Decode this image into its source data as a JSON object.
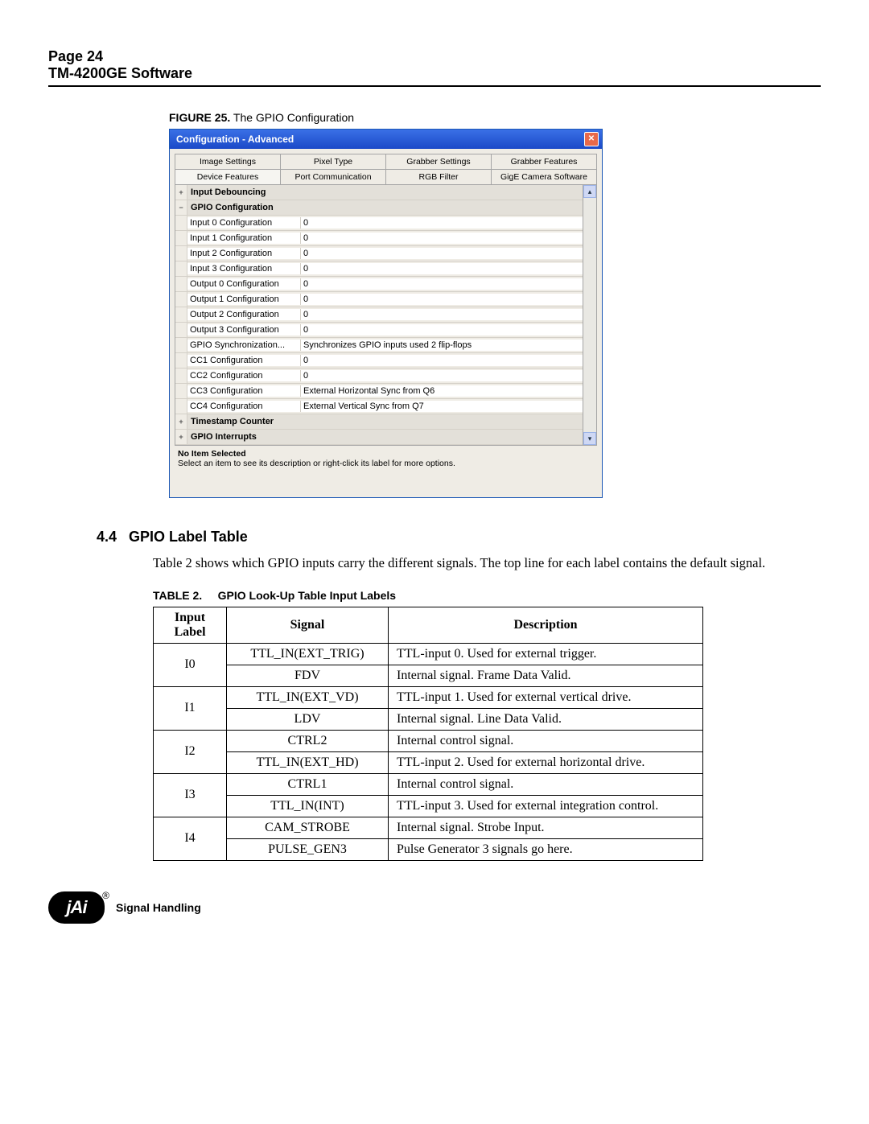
{
  "pageHeader": {
    "line1": "Page 24",
    "line2": "TM-4200GE Software"
  },
  "figure": {
    "label": "FIGURE 25.",
    "title": "  The GPIO Configuration"
  },
  "dialog": {
    "title": "Configuration - Advanced",
    "closeGlyph": "✕",
    "tabsRow1": [
      "Image Settings",
      "Pixel Type",
      "Grabber Settings",
      "Grabber Features"
    ],
    "tabsRow2": [
      "Device Features",
      "Port Communication",
      "RGB Filter",
      "GigE Camera Software"
    ],
    "sections": {
      "debounce": {
        "icon": "+",
        "label": "Input Debouncing"
      },
      "gpio": {
        "icon": "−",
        "label": "GPIO Configuration"
      },
      "timestamp": {
        "icon": "+",
        "label": "Timestamp Counter"
      },
      "interrupts": {
        "icon": "+",
        "label": "GPIO Interrupts"
      }
    },
    "properties": [
      {
        "name": "Input 0 Configuration",
        "value": "0"
      },
      {
        "name": "Input 1 Configuration",
        "value": "0"
      },
      {
        "name": "Input 2 Configuration",
        "value": "0"
      },
      {
        "name": "Input 3 Configuration",
        "value": "0"
      },
      {
        "name": "Output 0 Configuration",
        "value": "0"
      },
      {
        "name": "Output 1 Configuration",
        "value": "0"
      },
      {
        "name": "Output 2 Configuration",
        "value": "0"
      },
      {
        "name": "Output 3 Configuration",
        "value": "0"
      },
      {
        "name": "GPIO Synchronization...",
        "value": "Synchronizes GPIO inputs used 2 flip-flops"
      },
      {
        "name": "CC1 Configuration",
        "value": "0"
      },
      {
        "name": "CC2 Configuration",
        "value": "0"
      },
      {
        "name": "CC3 Configuration",
        "value": "External Horizontal Sync from Q6"
      },
      {
        "name": "CC4 Configuration",
        "value": "External Vertical Sync from Q7"
      }
    ],
    "desc": {
      "title": "No Item Selected",
      "text": "Select an item to see its description or right-click its label for more options."
    },
    "scroll": {
      "up": "▴",
      "down": "▾"
    }
  },
  "section": {
    "number": "4.4",
    "title": "GPIO Label Table"
  },
  "bodyText": "Table 2  shows which GPIO inputs carry the different signals. The top line for each label contains the default signal.",
  "tableCaption": {
    "label": "TABLE 2.",
    "title": "GPIO Look-Up Table Input Labels"
  },
  "tableHead": {
    "c1": "Input Label",
    "c2": "Signal",
    "c3": "Description"
  },
  "tableRows": [
    {
      "label": "I0",
      "signals": [
        "TTL_IN(EXT_TRIG)",
        "FDV"
      ],
      "descs": [
        "TTL-input 0. Used for external trigger.",
        "Internal signal. Frame Data Valid."
      ]
    },
    {
      "label": "I1",
      "signals": [
        "TTL_IN(EXT_VD)",
        "LDV"
      ],
      "descs": [
        "TTL-input 1. Used for external vertical drive.",
        "Internal signal. Line Data Valid."
      ]
    },
    {
      "label": "I2",
      "signals": [
        "CTRL2",
        "TTL_IN(EXT_HD)"
      ],
      "descs": [
        "Internal control signal.",
        "TTL-input 2. Used for external horizontal drive."
      ]
    },
    {
      "label": "I3",
      "signals": [
        "CTRL1",
        "TTL_IN(INT)"
      ],
      "descs": [
        "Internal control signal.",
        "TTL-input 3. Used for external integration control."
      ]
    },
    {
      "label": "I4",
      "signals": [
        "CAM_STROBE",
        "PULSE_GEN3"
      ],
      "descs": [
        "Internal signal. Strobe Input.",
        "Pulse Generator 3 signals go here."
      ]
    }
  ],
  "footer": {
    "logoText": "jAi",
    "reg": "®",
    "label": "Signal Handling"
  }
}
